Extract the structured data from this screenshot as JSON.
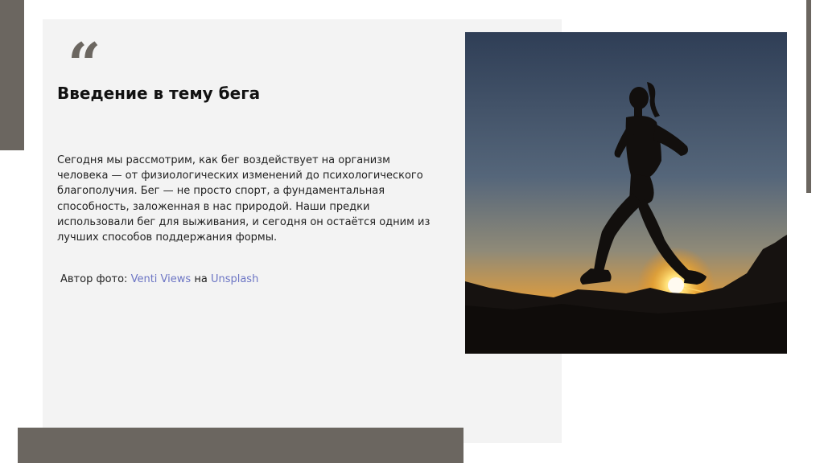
{
  "slide": {
    "quote_glyph": "“",
    "title": "Введение в тему бега",
    "body": "Сегодня мы рассмотрим, как бег воздействует на организм человека — от физиологических изменений до психологического благополучия. Бег — не просто спорт, а фундаментальная способность, заложенная в нас природой. Наши предки использовали бег для выживания, и сегодня он остаётся одним из лучших способов поддержания формы.",
    "credit": {
      "prefix": "Автор фото:",
      "author": "Venti Views",
      "connector": "на",
      "source": "Unsplash"
    },
    "photo": {
      "subject": "silhouette of a woman running at sunset"
    }
  },
  "colors": {
    "accent": "#6b6660",
    "card_background": "#f3f3f3",
    "link": "#6c75c4",
    "text": "#222222"
  }
}
